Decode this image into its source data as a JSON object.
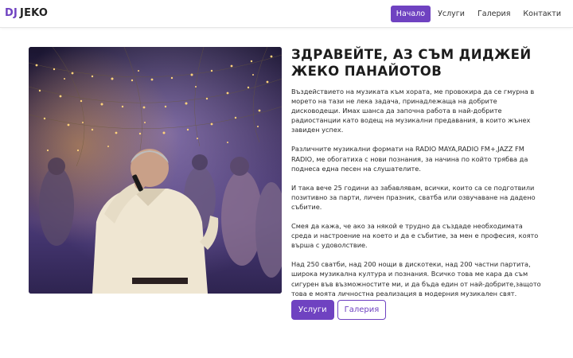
{
  "brand": {
    "prefix": "DJ",
    "name": "JEKO"
  },
  "nav": {
    "items": [
      {
        "label": "Начало",
        "active": true
      },
      {
        "label": "Услуги",
        "active": false
      },
      {
        "label": "Галерия",
        "active": false
      },
      {
        "label": "Контакти",
        "active": false
      }
    ]
  },
  "hero": {
    "title": "ЗДРАВЕЙТЕ, АЗ СЪМ ДИДЖЕЙ ЖЕКО ПАНАЙОТОВ",
    "paragraphs": [
      "Въздействието на музиката към хората, ме провокира да се гмурна в морето на тази не лека задача, принадлежаща на добрите дисководещи. Имах шанса да започна работа в най-добрите радиостанции като водещ на музикални предавания, в които жънех завиден успех.",
      "Различните музикални формати на RADIO MAYA,RADIO FM+,JAZZ FM RADIO, ме обогатиха с нови познания, за начина по който трябва да поднеса една песен на слушателите.",
      "И така вече 25 години аз забавлявам, всички, които са се подготвили позитивно за парти, личен празник, сватба или озвучаване на дадено събитие.",
      "Смея да кажа, че ако за някой е трудно да създаде необходимата среда и настроение на което и да е събитие, за мен е професия, която върша с удоволствие.",
      "Над 250 сватби, над 200 нощи в дискотеки, над 200 частни партита, широка музикална култура и познания. Всичко това ме кара да съм сигурен във възможностите ми, и да бъда един от най-добрите,защото това е моята личностна реализация в модерния музикален свят."
    ],
    "buttons": {
      "primary": "Услуги",
      "secondary": "Галерия"
    }
  },
  "colors": {
    "accent": "#6f42c1",
    "text": "#222222",
    "background": "#ffffff"
  }
}
